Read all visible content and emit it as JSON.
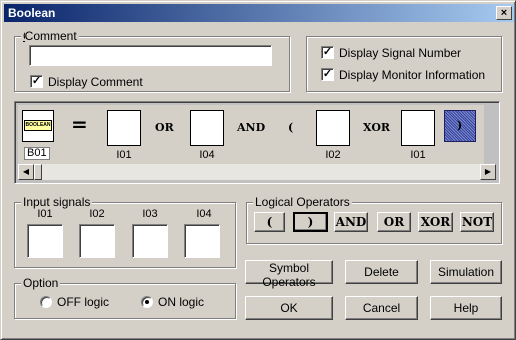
{
  "window": {
    "title": "Boolean",
    "close_glyph": "×"
  },
  "comment": {
    "group_label": "Comment",
    "input_value": "",
    "display_comment_label": "Display Comment",
    "display_comment_checked": true
  },
  "display_options": {
    "signal_number_label": "Display Signal Number",
    "signal_number_checked": true,
    "monitor_info_label": "Display Monitor Information",
    "monitor_info_checked": true
  },
  "expression": {
    "block_label": "B01",
    "block_icon_text": "BOOLEAN",
    "equals": "=",
    "items": [
      {
        "kind": "input",
        "label": "I01"
      },
      {
        "kind": "op",
        "text": "OR"
      },
      {
        "kind": "input",
        "label": "I04"
      },
      {
        "kind": "op",
        "text": "AND"
      },
      {
        "kind": "op",
        "text": "("
      },
      {
        "kind": "input",
        "label": "I02"
      },
      {
        "kind": "op",
        "text": "XOR"
      },
      {
        "kind": "input",
        "label": "I01"
      },
      {
        "kind": "op",
        "text": ")"
      }
    ]
  },
  "input_signals": {
    "group_label": "Input signals",
    "signals": [
      "I01",
      "I02",
      "I03",
      "I04"
    ]
  },
  "logical_operators": {
    "group_label": "Logical Operators",
    "buttons": [
      "(",
      ")",
      "AND",
      "OR",
      "XOR",
      "NOT"
    ]
  },
  "option": {
    "group_label": "Option",
    "off_label": "OFF logic",
    "on_label": "ON logic",
    "selected": "on"
  },
  "buttons": {
    "symbol_operators": "Symbol Operators",
    "delete": "Delete",
    "simulation": "Simulation",
    "ok": "OK",
    "cancel": "Cancel",
    "help": "Help"
  },
  "icons": {
    "check": "✓",
    "scroll_left": "◀",
    "scroll_right": "▶"
  }
}
